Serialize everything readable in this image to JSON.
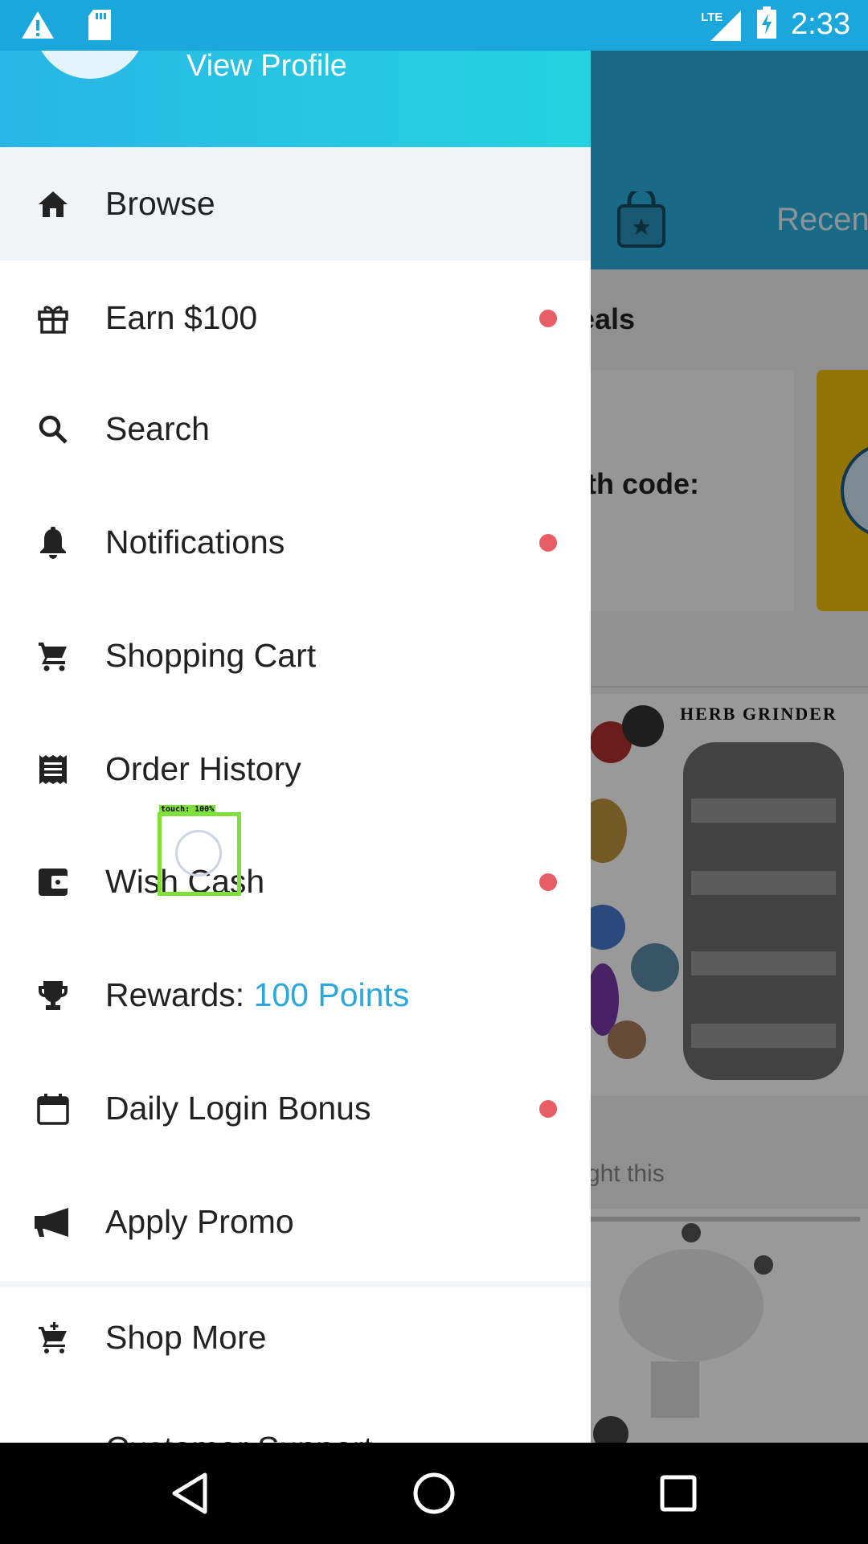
{
  "status_bar": {
    "time": "2:33",
    "network": "LTE",
    "icons": [
      "warning-icon",
      "sd-card-icon",
      "signal-icon",
      "battery-charging-icon"
    ]
  },
  "drawer": {
    "header": {
      "profile_link": "View Profile"
    },
    "menu": [
      {
        "label": "Browse",
        "icon": "home-icon",
        "active": true,
        "badge": false
      },
      {
        "label": "Earn $100",
        "icon": "gift-icon",
        "active": false,
        "badge": true
      },
      {
        "label": "Search",
        "icon": "search-icon",
        "active": false,
        "badge": false
      },
      {
        "label": "Notifications",
        "icon": "bell-icon",
        "active": false,
        "badge": true
      },
      {
        "label": "Shopping Cart",
        "icon": "cart-icon",
        "active": false,
        "badge": false
      },
      {
        "label": "Order History",
        "icon": "receipt-icon",
        "active": false,
        "badge": false
      },
      {
        "label": "Wish Cash",
        "icon": "wallet-icon",
        "active": false,
        "badge": true
      },
      {
        "label": "Rewards: ",
        "label_accent": "100 Points",
        "icon": "trophy-icon",
        "active": false,
        "badge": false
      },
      {
        "label": "Daily Login Bonus",
        "icon": "calendar-icon",
        "active": false,
        "badge": true
      },
      {
        "label": "Apply Promo",
        "icon": "megaphone-icon",
        "active": false,
        "badge": false
      },
      {
        "label": "Shop More",
        "icon": "add-cart-icon",
        "active": false,
        "badge": false
      }
    ],
    "partial_item": "Customer Support"
  },
  "touch_marker": {
    "label": "touch: 100%"
  },
  "background": {
    "tab_text": "Recen",
    "section_title": "eals",
    "card_text": "th code:",
    "product_title": "HERB GRINDER",
    "faded_text": "ght this"
  },
  "colors": {
    "status_bar": "#1ba6dc",
    "accent": "#2aa8dc",
    "badge": "#e85c64",
    "active_row": "#f1f4f7"
  },
  "nav_bar": {
    "buttons": [
      "back-icon",
      "home-circle-icon",
      "recents-icon"
    ]
  }
}
